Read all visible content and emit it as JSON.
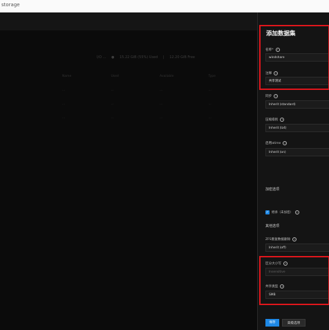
{
  "browser": {
    "url": "storage"
  },
  "background": {
    "stats": [
      "I/O ... ",
      "● ",
      "15.22 GiB (55%) Used ",
      " | ",
      " 12.20 GiB Free"
    ],
    "rows": [
      [
        "Name",
        "Used",
        "Available",
        "Type"
      ],
      [
        "...",
        "...",
        "...",
        "..."
      ],
      [
        "...",
        "...",
        "...",
        "..."
      ],
      [
        "...",
        "...",
        "...",
        "..."
      ]
    ]
  },
  "panel": {
    "title": "添加数据集",
    "fields": [
      {
        "label": "名称*",
        "value": "windshare"
      },
      {
        "label": "注释",
        "value": "共享测试"
      },
      {
        "label": "同步",
        "value": "Inherit (standard)"
      },
      {
        "label": "压缩级别",
        "value": "Inherit (lz4)"
      },
      {
        "label": "启用atime",
        "value": "Inherit (on)"
      }
    ],
    "encryption_section": "加密选项",
    "encryption_checkbox": "继承（未加密）",
    "other_section": "其他选项",
    "dedup_label": "ZFS重复数据删除",
    "dedup_value": "Inherit (off)",
    "case_label": "区分大小写",
    "case_value": "Insensitive",
    "share_label": "共享类型",
    "share_value": "SMB",
    "save_button": "保存",
    "advanced_button": "高级选项"
  }
}
